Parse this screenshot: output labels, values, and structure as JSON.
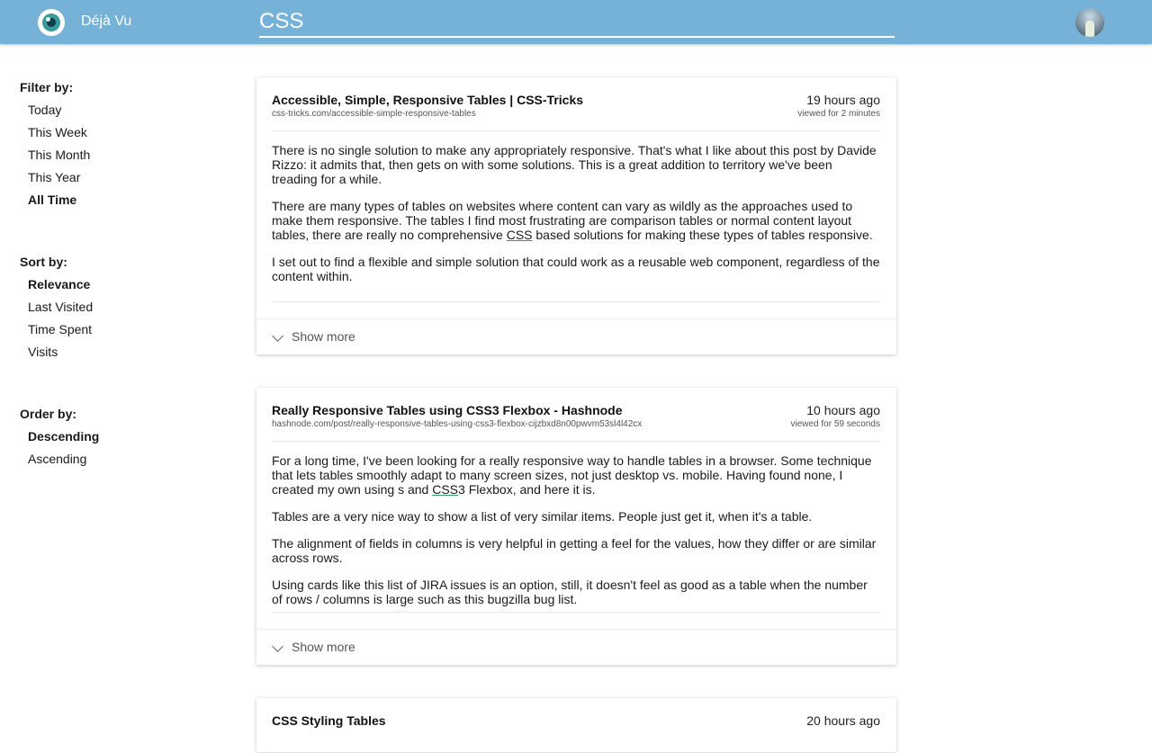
{
  "app": {
    "name": "Déjà Vu"
  },
  "search": {
    "value": "CSS"
  },
  "sidebar": {
    "filter": {
      "heading": "Filter by:",
      "items": [
        "Today",
        "This Week",
        "This Month",
        "This Year",
        "All Time"
      ],
      "active": "All Time"
    },
    "sort": {
      "heading": "Sort by:",
      "items": [
        "Relevance",
        "Last Visited",
        "Time Spent",
        "Visits"
      ],
      "active": "Relevance"
    },
    "order": {
      "heading": "Order by:",
      "items": [
        "Descending",
        "Ascending"
      ],
      "active": "Descending"
    }
  },
  "results": [
    {
      "title": "Accessible, Simple, Responsive Tables | CSS-Tricks",
      "url": "css-tricks.com/accessible-simple-responsive-tables",
      "time_ago": "19 hours ago",
      "viewed_for": "viewed for 2 minutes",
      "paragraphs": [
        "There is no single solution to make any appropriately responsive. That's what I like about this post by Davide Rizzo: it admits that, then gets on with some solutions. This is a great addition to territory we've been treading for a while.",
        [
          "There are many types of tables on websites where content can vary as wildly as the approaches used to make them responsive. The tables I find most frustrating are comparison tables or normal content layout tables, there are really no comprehensive ",
          "CSS",
          " based solutions for making these types of tables responsive."
        ],
        "I set out to find a flexible and simple solution that could work as a reusable web component, regardless of the content within."
      ],
      "show_more": "Show more"
    },
    {
      "title": "Really Responsive Tables using CSS3 Flexbox - Hashnode",
      "url": "hashnode.com/post/really-responsive-tables-using-css3-flexbox-cijzbxd8n00pwvm53sl4l42cx",
      "time_ago": "10 hours ago",
      "viewed_for": "viewed for 59 seconds",
      "paragraphs": [
        [
          "For a long time, I've been looking for a really responsive way to handle tables in a browser. Some technique that lets tables smoothly adapt to many screen sizes, not just desktop vs. mobile. Having found none, I created my own using s and ",
          "CSS",
          "3 Flexbox, and here it is."
        ],
        "Tables are a very nice way to show a list of very similar items. People just get it, when it's a table.",
        "The alignment of fields in columns is very helpful in getting a feel for the values, how they differ or are similar across rows.",
        "Using cards like this list of JIRA issues is an option, still, it doesn't feel as good as a table when the number of rows / columns is large such as this bugzilla bug list."
      ],
      "show_more": "Show more"
    },
    {
      "title": "CSS Styling Tables",
      "time_ago": "20 hours ago"
    }
  ],
  "colors": {
    "topbar": "#76b2d8",
    "keyword_underline": "#2e9e6a"
  },
  "icons": {
    "logo": "eye-logo-icon",
    "show_more": "chevron-down-icon"
  }
}
